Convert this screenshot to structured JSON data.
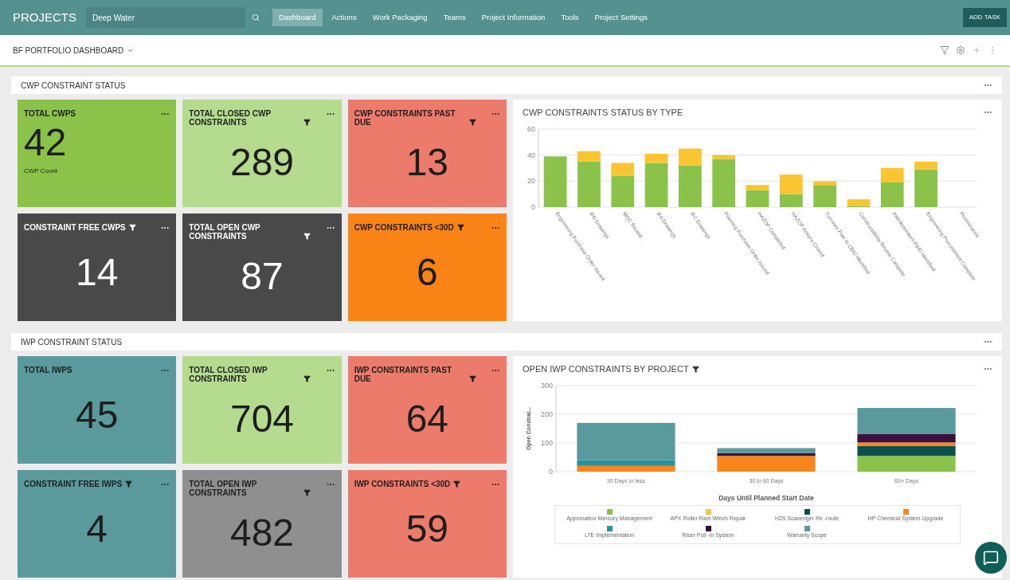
{
  "nav": {
    "brand": "PROJECTS",
    "search": {
      "value": "Deep Water"
    },
    "tabs": [
      {
        "label": "Dashboard",
        "selected": true
      },
      {
        "label": "Actions",
        "selected": false
      },
      {
        "label": "Work Packaging",
        "selected": false
      },
      {
        "label": "Teams",
        "selected": false
      },
      {
        "label": "Project Information",
        "selected": false
      },
      {
        "label": "Tools",
        "selected": false
      },
      {
        "label": "Project Settings",
        "selected": false
      }
    ],
    "action": "ADD TASK"
  },
  "toolbar": {
    "title": "BF PORTFOLIO DASHBOARD"
  },
  "sections": [
    {
      "title": "CWP CONSTRAINT STATUS",
      "tiles": [
        {
          "title": "TOTAL CWPS",
          "value": "42",
          "subtitle": "CWP Count",
          "filter": false,
          "color": "#8bc34a"
        },
        {
          "title": "TOTAL CLOSED CWP CONSTRAINTS",
          "value": "289",
          "filter": true,
          "color": "#b5dc8e"
        },
        {
          "title": "CWP CONSTRAINTS PAST DUE",
          "value": "13",
          "filter": true,
          "color": "#ec7b6c"
        },
        {
          "title": "CONSTRAINT FREE CWPS",
          "value": "14",
          "filter": true,
          "color": "#494949"
        },
        {
          "title": "TOTAL OPEN CWP CONSTRAINTS",
          "value": "87",
          "filter": true,
          "color": "#494949"
        },
        {
          "title": "CWP CONSTRAINTS <30D",
          "value": "6",
          "filter": true,
          "color": "#fb8416"
        }
      ],
      "chart": {
        "title": "CWP CONSTRAINTS STATUS BY TYPE",
        "filter": false,
        "chart_data": {
          "type": "bar",
          "stacked": true,
          "categories": [
            "Engineering Purchase Order Issued",
            "IFR Drawings",
            "MOC Routed",
            "IFA Drawings",
            "IFC Drawings",
            "Planning Purchase Order Issued",
            "HAZOP Completed",
            "HAZOP Actions Closed",
            "Turnover Plan to CBIU Identified",
            "Constructability Review Complete",
            "Interdependent P&ID Identified",
            "Engineering Procurement Complete",
            "Preliminaries"
          ],
          "series": [
            {
              "color": "#8bc34a",
              "values": [
                39,
                35,
                24,
                34,
                32,
                37,
                13,
                10,
                17,
                1,
                19,
                29,
                0
              ]
            },
            {
              "color": "#fbc531",
              "values": [
                0,
                8,
                10,
                7,
                13,
                3,
                4,
                15,
                3,
                5,
                11,
                6,
                0
              ]
            }
          ],
          "ylim": [
            0,
            60
          ],
          "yticks": [
            0,
            20,
            40,
            60
          ]
        }
      }
    },
    {
      "title": "IWP CONSTRAINT STATUS",
      "tiles": [
        {
          "title": "TOTAL IWPS",
          "value": "45",
          "filter": false,
          "color": "#5a9a9c"
        },
        {
          "title": "TOTAL CLOSED IWP CONSTRAINTS",
          "value": "704",
          "filter": true,
          "color": "#b5dc8e"
        },
        {
          "title": "IWP CONSTRAINTS PAST DUE",
          "value": "64",
          "filter": true,
          "color": "#ec7b6c"
        },
        {
          "title": "CONSTRAINT FREE IWPS",
          "value": "4",
          "filter": true,
          "color": "#5a9a9c"
        },
        {
          "title": "TOTAL OPEN IWP CONSTRAINTS",
          "value": "482",
          "filter": true,
          "color": "#8f8f8f"
        },
        {
          "title": "IWP CONSTRAINTS <30D",
          "value": "59",
          "filter": true,
          "color": "#ec7b6c"
        }
      ],
      "chart": {
        "title": "OPEN IWP CONSTRAINTS BY PROJECT",
        "filter": true,
        "chart_data": {
          "type": "bar",
          "stacked": true,
          "xlabel": "Days Until Planned Start Date",
          "ylabel": "Open Constrai...",
          "categories": [
            "30 Days or less",
            "30 to 60 Days",
            "60+ Days"
          ],
          "series": [
            {
              "name": "Appomattox Mercury Management",
              "color": "#8bc34a",
              "values": [
                0,
                0,
                55
              ]
            },
            {
              "name": "APX Roller Ram Winch Repair",
              "color": "#f4c542",
              "values": [
                0,
                0,
                0
              ]
            },
            {
              "name": "H2S Scavenger Re -route",
              "color": "#0d4f4a",
              "values": [
                0,
                0,
                35
              ]
            },
            {
              "name": "HP Chemical System Upgrade",
              "color": "#f7861c",
              "values": [
                20,
                55,
                12
              ]
            },
            {
              "name": "LTE Implementation",
              "color": "#26949a",
              "values": [
                20,
                0,
                0
              ]
            },
            {
              "name": "Riser Pull -in System",
              "color": "#3b1040",
              "values": [
                0,
                10,
                30
              ]
            },
            {
              "name": "Warranty Scope",
              "color": "#5a9a9c",
              "values": [
                130,
                17,
                90
              ]
            }
          ],
          "ylim": [
            0,
            300
          ],
          "yticks": [
            0,
            100,
            200,
            300
          ]
        }
      }
    }
  ]
}
